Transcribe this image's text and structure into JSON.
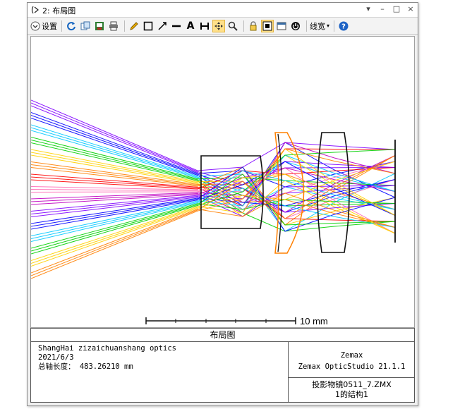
{
  "window": {
    "title": "2: 布局图",
    "controls": [
      "▾",
      "–",
      "□",
      "×"
    ]
  },
  "toolbar": {
    "settings_label": "设置",
    "linewidth_label": "线宽",
    "text_tool_label": "A"
  },
  "plot": {
    "scale_label": "10 mm"
  },
  "footer": {
    "title": "布局图",
    "company": "ShangHai zizaichuanshang optics",
    "date": "2021/6/3",
    "total_length": "总轴长度：  483.26210 mm",
    "vendor": "Zemax",
    "software": "Zemax OpticStudio 21.1.1",
    "file": "投影物镜0511_7.ZMX",
    "config": "1的结构1"
  },
  "colors": {
    "ray_colors": [
      "#8000ff",
      "#0000ff",
      "#00c8ff",
      "#00d000",
      "#ffd000",
      "#ff7f00",
      "#ff0000",
      "#ff69b4",
      "#c000c0"
    ],
    "lens_orange": "#ff8000",
    "active_tool": "#ffe08a"
  }
}
